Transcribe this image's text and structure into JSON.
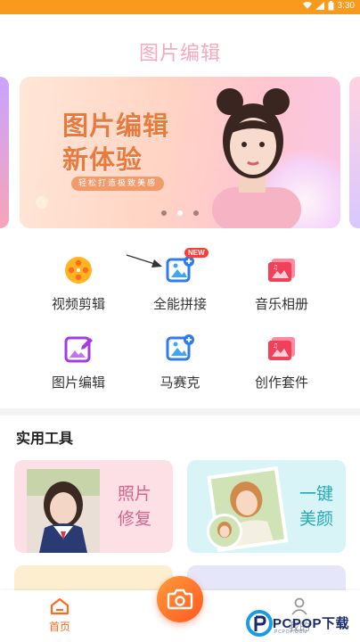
{
  "status_bar": {
    "time": "3:30",
    "background": "#f89a1c"
  },
  "header": {
    "title": "图片编辑"
  },
  "banner": {
    "headline_line1": "图片编辑",
    "headline_line2": "新体验",
    "tagline": "轻松打造极致美感",
    "carousel_page": 1,
    "carousel_count": 3
  },
  "features": [
    {
      "label": "视频剪辑",
      "icon": "film-reel-icon"
    },
    {
      "label": "全能拼接",
      "icon": "image-add-icon",
      "badge": "NEW"
    },
    {
      "label": "音乐相册",
      "icon": "photo-album-icon"
    },
    {
      "label": "图片编辑",
      "icon": "image-edit-icon"
    },
    {
      "label": "马赛克",
      "icon": "image-add-icon"
    },
    {
      "label": "创作套件",
      "icon": "photo-album-icon"
    }
  ],
  "tools": {
    "title": "实用工具",
    "cards": [
      {
        "line1": "照片",
        "line2": "修复"
      },
      {
        "line1": "一键",
        "line2": "美颜"
      }
    ]
  },
  "tabbar": {
    "home_label": "首页",
    "me_label": "我的",
    "accent": "#ff6a1f"
  },
  "watermark": {
    "brand": "PCPOP下载",
    "sub": "PCPOP.COM"
  }
}
